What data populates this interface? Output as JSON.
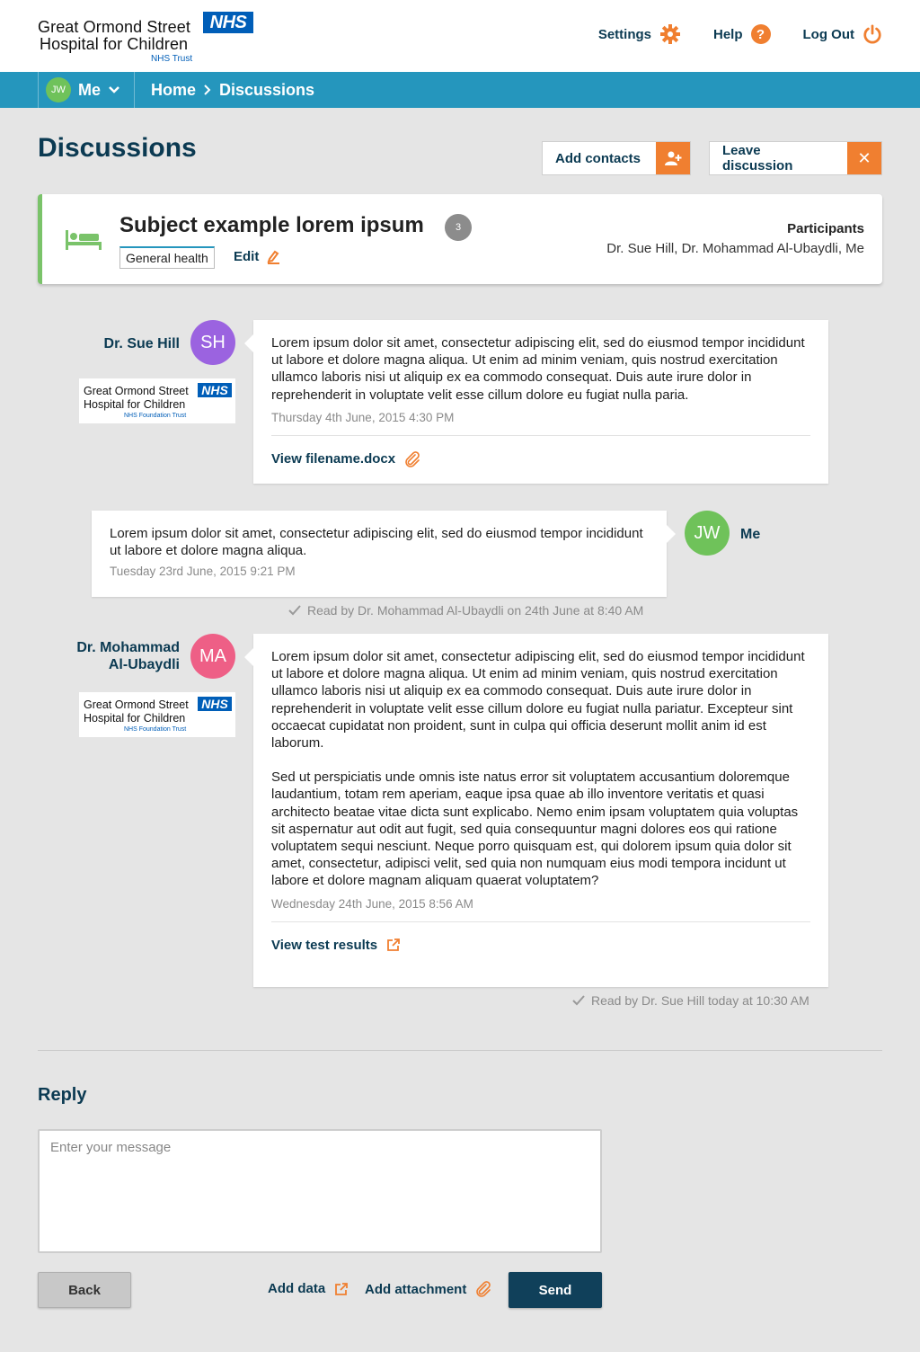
{
  "header": {
    "logo": {
      "line1": "Great Ormond Street",
      "line2": "Hospital for Children",
      "nhs": "NHS",
      "trust": "NHS Trust"
    },
    "links": [
      {
        "label": "Settings",
        "icon": "gear-icon"
      },
      {
        "label": "Help",
        "icon": "help-icon"
      },
      {
        "label": "Log Out",
        "icon": "power-icon"
      }
    ]
  },
  "nav": {
    "user_initials": "JW",
    "user_label": "Me",
    "breadcrumb": [
      "Home",
      "Discussions"
    ]
  },
  "page": {
    "title": "Discussions",
    "add_contacts": "Add contacts",
    "leave_discussion": "Leave discussion"
  },
  "subject": {
    "title": "Subject example lorem ipsum",
    "count": "3",
    "tag": "General health",
    "edit": "Edit",
    "participants_label": "Participants",
    "participants": "Dr. Sue Hill, Dr. Mohammad Al-Ubaydli, Me"
  },
  "org_logo": {
    "line1": "Great Ormond Street",
    "line2": "Hospital for Children",
    "nhs": "NHS",
    "trust": "NHS Foundation Trust"
  },
  "messages": [
    {
      "author": "Dr. Sue Hill",
      "initials": "SH",
      "color": "#9b63e0",
      "paragraphs": [
        "Lorem ipsum dolor sit amet, consectetur adipiscing elit, sed do eiusmod tempor incididunt ut labore et dolore magna aliqua. Ut enim ad minim veniam, quis nostrud exercitation ullamco laboris nisi ut aliquip ex ea commodo consequat. Duis aute irure dolor in reprehenderit in voluptate velit esse cillum dolore eu fugiat nulla paria."
      ],
      "time": "Thursday 4th June, 2015 4:30 PM",
      "attachment": "View filename.docx"
    },
    {
      "author": "Me",
      "initials": "JW",
      "color": "#6fc25a",
      "paragraphs": [
        "Lorem ipsum dolor sit amet, consectetur adipiscing elit, sed do eiusmod tempor incididunt ut labore et dolore magna aliqua."
      ],
      "time": "Tuesday 23rd June, 2015 9:21 PM",
      "receipt": "Read by Dr. Mohammad Al-Ubaydli on 24th June at 8:40 AM"
    },
    {
      "author_line1": "Dr. Mohammad",
      "author_line2": "Al-Ubaydli",
      "initials": "MA",
      "color": "#ee5f86",
      "paragraphs": [
        "Lorem ipsum dolor sit amet, consectetur adipiscing elit, sed do eiusmod tempor incididunt ut labore et dolore magna aliqua. Ut enim ad minim veniam, quis nostrud exercitation ullamco laboris nisi ut aliquip ex ea commodo consequat. Duis aute irure dolor in reprehenderit in voluptate velit esse cillum dolore eu fugiat nulla pariatur. Excepteur sint occaecat cupidatat non proident, sunt in culpa qui officia deserunt mollit anim id est laborum.",
        "Sed ut perspiciatis unde omnis iste natus error sit voluptatem accusantium doloremque laudantium, totam rem aperiam, eaque ipsa quae ab illo inventore veritatis et quasi architecto beatae vitae dicta sunt explicabo. Nemo enim ipsam voluptatem quia voluptas sit aspernatur aut odit aut fugit, sed quia consequuntur magni dolores eos qui ratione voluptatem sequi nesciunt. Neque porro quisquam est, qui dolorem ipsum quia dolor sit amet, consectetur, adipisci velit, sed quia non numquam eius modi tempora incidunt ut labore et dolore magnam aliquam quaerat voluptatem?"
      ],
      "time": "Wednesday 24th June, 2015 8:56 AM",
      "attachment": "View test results",
      "receipt": "Read by Dr. Sue Hill today at 10:30 AM"
    }
  ],
  "reply": {
    "title": "Reply",
    "placeholder": "Enter your message",
    "back": "Back",
    "add_data": "Add data",
    "add_attachment": "Add attachment",
    "send": "Send"
  },
  "colors": {
    "primary": "#0b3a52",
    "navbar": "#2596bd",
    "accent": "#f07f30",
    "subject_border": "#7ac36a"
  }
}
